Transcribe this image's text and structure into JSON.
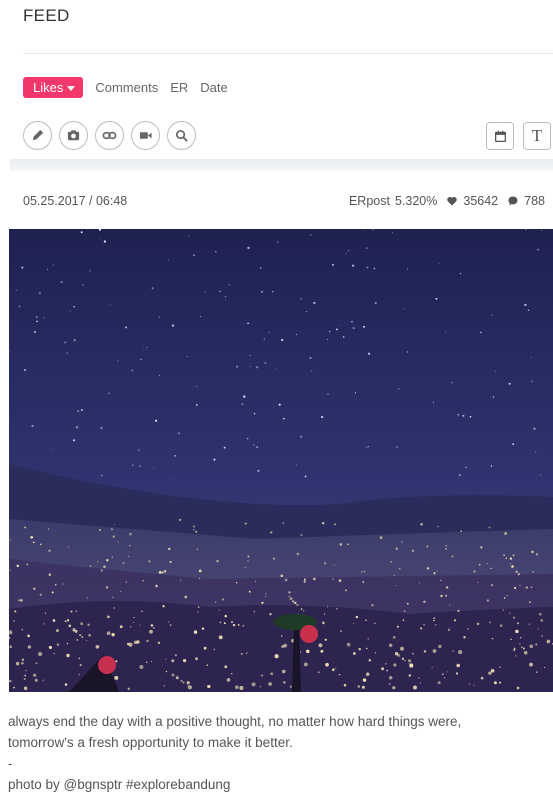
{
  "header": {
    "title": "FEED"
  },
  "sort": {
    "active": "Likes",
    "options": [
      "Comments",
      "ER",
      "Date"
    ]
  },
  "toolbar": {
    "icons": [
      "pencil-icon",
      "camera-icon",
      "link-icon",
      "video-icon",
      "search-icon"
    ],
    "right_icons": [
      "calendar-icon",
      "text-icon"
    ],
    "text_icon_glyph": "T"
  },
  "post": {
    "datetime": "05.25.2017 / 06:48",
    "er_label": "ERpost",
    "er_value": "5.320%",
    "likes": "35642",
    "comments": "788",
    "caption": "always end the day with a positive thought, no matter how hard things were,\ntomorrow's a fresh opportunity to make it better.\n-\nphoto by @bgnsptr #explorebandung"
  },
  "colors": {
    "accent": "#f2386a",
    "sky": "#262a5a",
    "city_lights": "#f5e6b8"
  }
}
